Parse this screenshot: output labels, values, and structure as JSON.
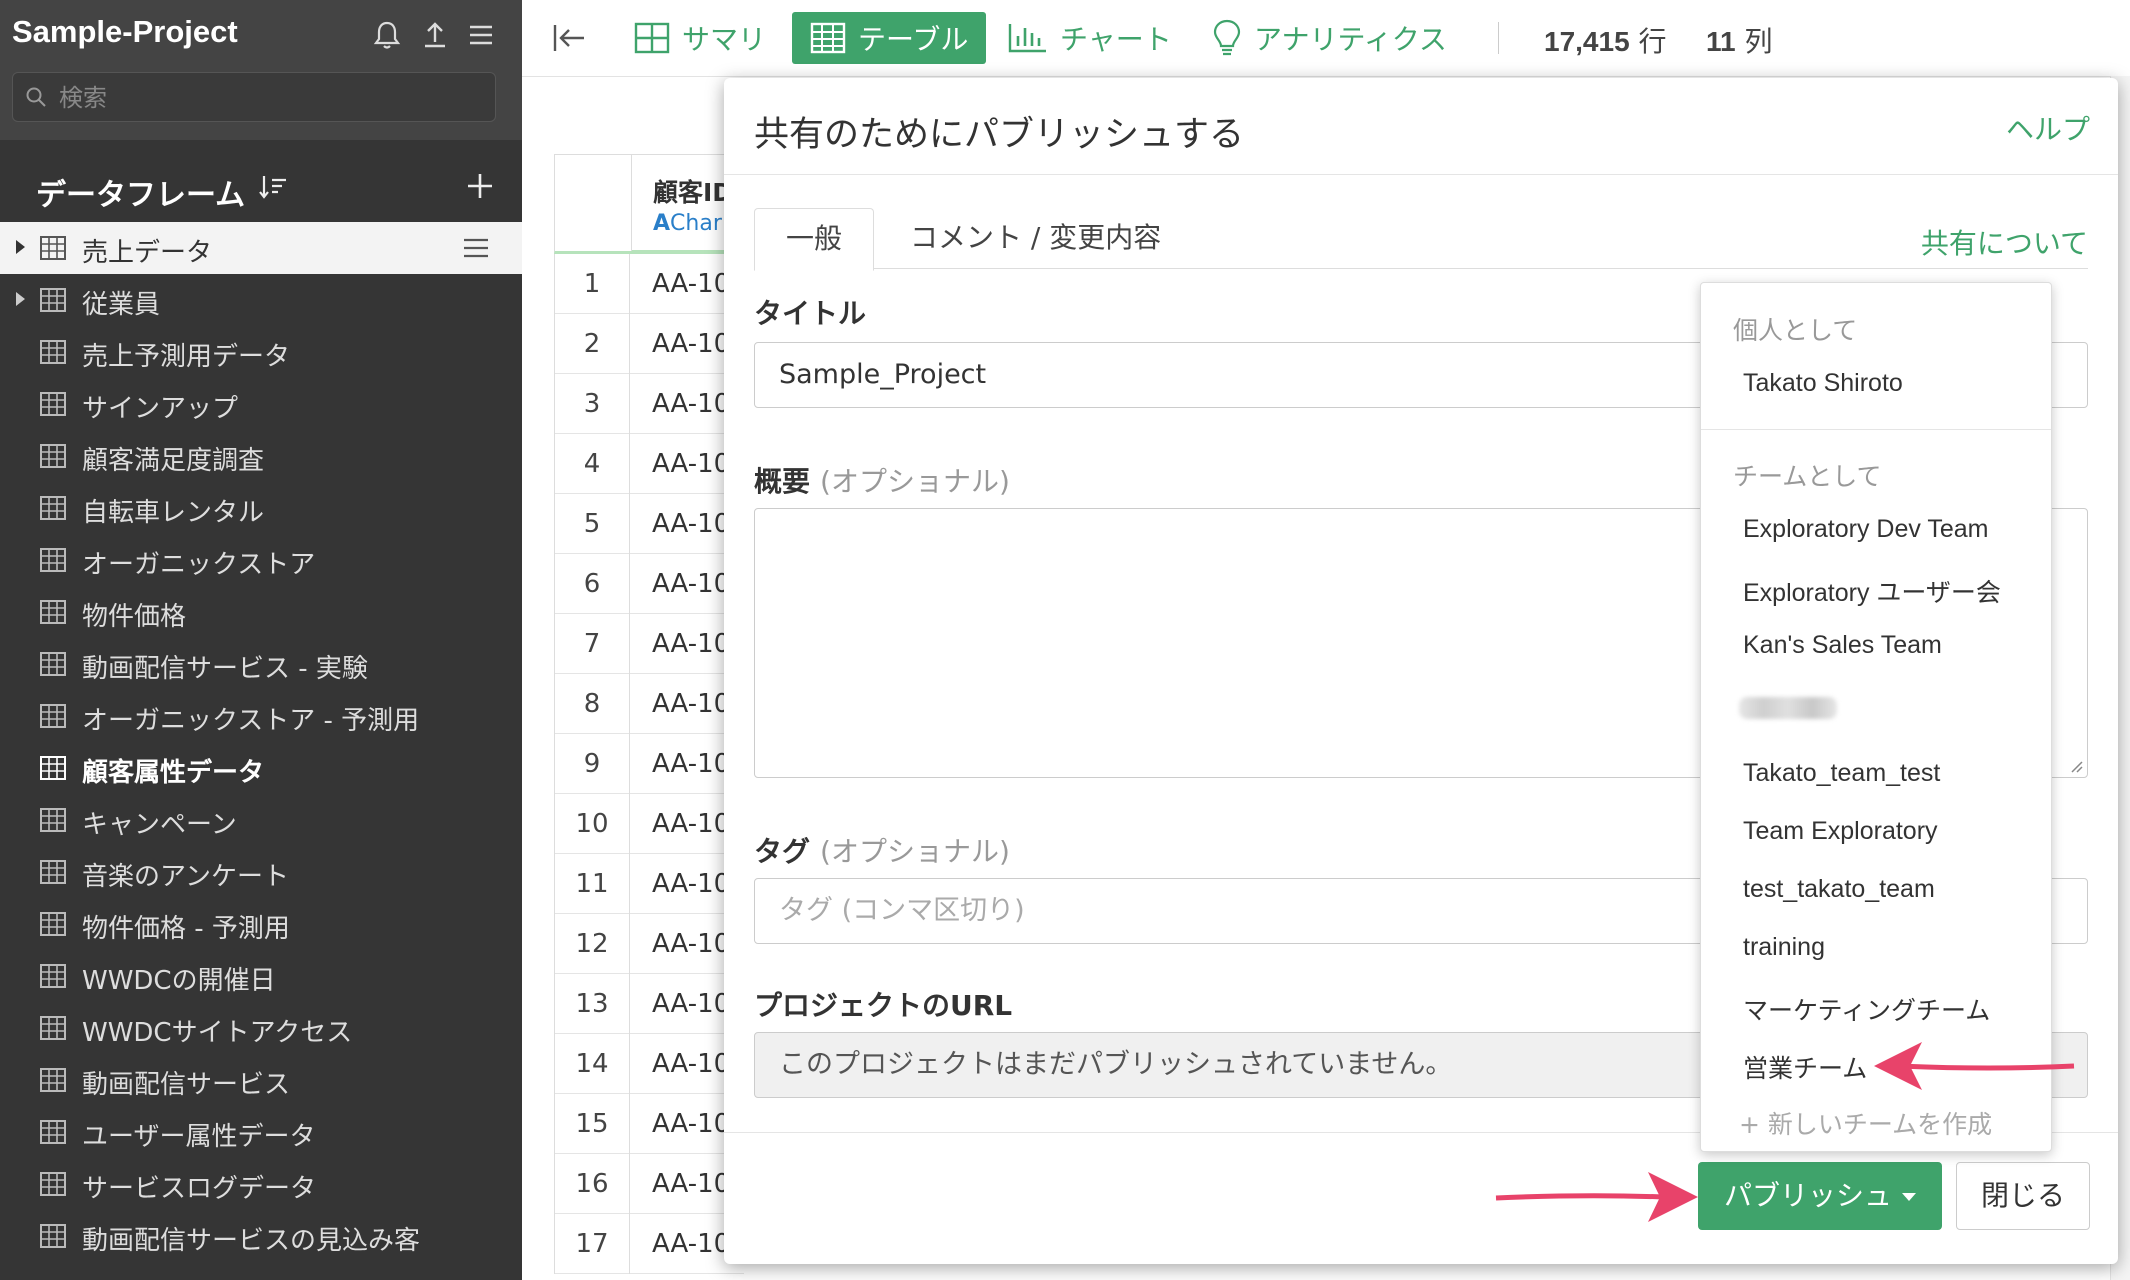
{
  "sidebar": {
    "project_name": "Sample-Project",
    "search_placeholder": "検索",
    "dataframes_title": "データフレーム",
    "items": [
      {
        "label": "売上データ"
      },
      {
        "label": "従業員"
      },
      {
        "label": "売上予測用データ"
      },
      {
        "label": "サインアップ"
      },
      {
        "label": "顧客満足度調査"
      },
      {
        "label": "自転車レンタル"
      },
      {
        "label": "オーガニックストア"
      },
      {
        "label": "物件価格"
      },
      {
        "label": "動画配信サービス - 実験"
      },
      {
        "label": "オーガニックストア - 予測用"
      },
      {
        "label": "顧客属性データ"
      },
      {
        "label": "キャンペーン"
      },
      {
        "label": "音楽のアンケート"
      },
      {
        "label": "物件価格 - 予測用"
      },
      {
        "label": "WWDCの開催日"
      },
      {
        "label": "WWDCサイトアクセス"
      },
      {
        "label": "動画配信サービス"
      },
      {
        "label": "ユーザー属性データ"
      },
      {
        "label": "サービスログデータ"
      },
      {
        "label": "動画配信サービスの見込み客"
      }
    ]
  },
  "toolbar": {
    "summary": "サマリ",
    "table": "テーブル",
    "chart": "チャート",
    "analytics": "アナリティクス",
    "rows_count": "17,415",
    "rows_unit": "行",
    "cols_count": "11",
    "cols_unit": "列"
  },
  "table": {
    "column_name": "顧客ID",
    "column_type_letter": "A",
    "column_type": "Char",
    "rows": [
      {
        "n": "1",
        "v": "AA-10"
      },
      {
        "n": "2",
        "v": "AA-10"
      },
      {
        "n": "3",
        "v": "AA-10"
      },
      {
        "n": "4",
        "v": "AA-10"
      },
      {
        "n": "5",
        "v": "AA-10"
      },
      {
        "n": "6",
        "v": "AA-10"
      },
      {
        "n": "7",
        "v": "AA-10"
      },
      {
        "n": "8",
        "v": "AA-10"
      },
      {
        "n": "9",
        "v": "AA-10"
      },
      {
        "n": "10",
        "v": "AA-10"
      },
      {
        "n": "11",
        "v": "AA-10"
      },
      {
        "n": "12",
        "v": "AA-10"
      },
      {
        "n": "13",
        "v": "AA-10"
      },
      {
        "n": "14",
        "v": "AA-10"
      },
      {
        "n": "15",
        "v": "AA-10"
      },
      {
        "n": "16",
        "v": "AA-10"
      },
      {
        "n": "17",
        "v": "AA-10"
      }
    ]
  },
  "modal": {
    "title": "共有のためにパブリッシュする",
    "help": "ヘルプ",
    "tab_general": "一般",
    "tab_comment": "コメント / 変更内容",
    "about_sharing": "共有について",
    "label_title": "タイトル",
    "title_value": "Sample_Project",
    "label_summary": "概要",
    "optional": "(オプショナル)",
    "label_tags": "タグ",
    "tags_placeholder": "タグ (コンマ区切り)",
    "label_url": "プロジェクトのURL",
    "url_text": "このプロジェクトはまだパブリッシュされていません。",
    "publish": "パブリッシュ",
    "close": "閉じる"
  },
  "dropdown": {
    "personal_header": "個人として",
    "personal_user": "Takato Shiroto",
    "team_header": "チームとして",
    "teams": [
      "Exploratory Dev Team",
      "Exploratory ユーザー会",
      "Kan's Sales Team",
      "Takato_team_test",
      "Team Exploratory",
      "test_takato_team",
      "training",
      "マーケティングチーム",
      "営業チーム"
    ],
    "new_team": "+ 新しいチームを作成"
  },
  "colors": {
    "accent": "#3fa36b",
    "sidebar_bg": "#353535",
    "annotation_arrow": "#e8436a"
  }
}
